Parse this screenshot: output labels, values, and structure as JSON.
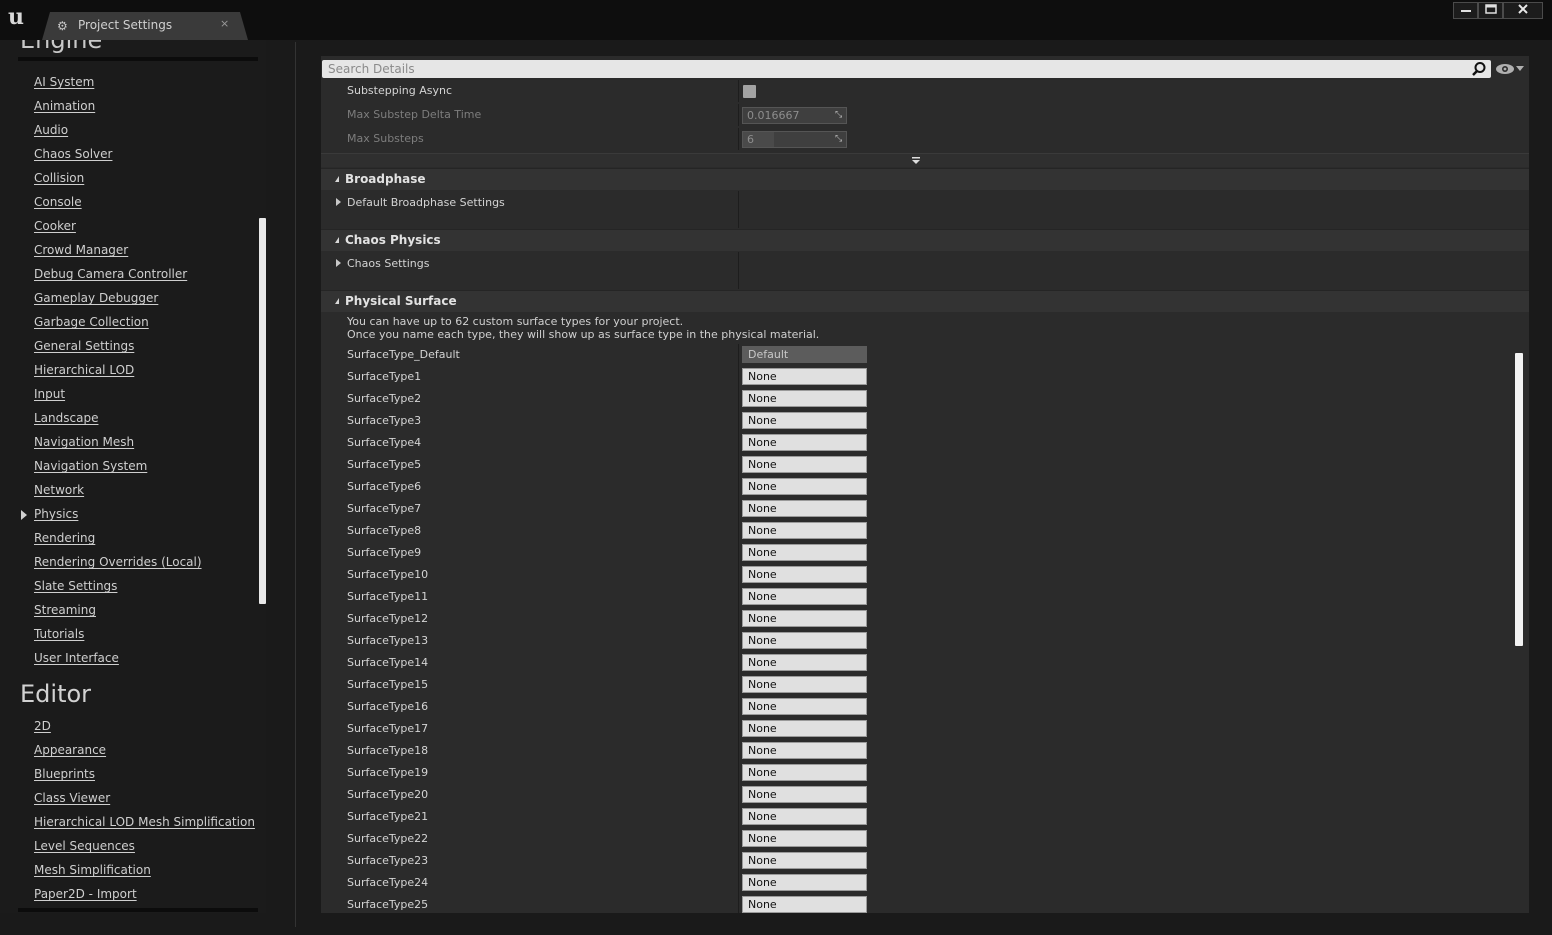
{
  "window": {
    "tab_title": "Project Settings",
    "tab_close": "×",
    "minimize": "▬",
    "maximize": "▭",
    "close": "✕"
  },
  "sidebar": {
    "engine_heading": "Engine",
    "engine_items": [
      {
        "label": "AI System"
      },
      {
        "label": "Animation"
      },
      {
        "label": "Audio"
      },
      {
        "label": "Chaos Solver"
      },
      {
        "label": "Collision"
      },
      {
        "label": "Console"
      },
      {
        "label": "Cooker"
      },
      {
        "label": "Crowd Manager"
      },
      {
        "label": "Debug Camera Controller"
      },
      {
        "label": "Gameplay Debugger"
      },
      {
        "label": "Garbage Collection"
      },
      {
        "label": "General Settings"
      },
      {
        "label": "Hierarchical LOD"
      },
      {
        "label": "Input"
      },
      {
        "label": "Landscape"
      },
      {
        "label": "Navigation Mesh"
      },
      {
        "label": "Navigation System"
      },
      {
        "label": "Network"
      },
      {
        "label": "Physics",
        "selected": true
      },
      {
        "label": "Rendering"
      },
      {
        "label": "Rendering Overrides (Local)"
      },
      {
        "label": "Slate Settings"
      },
      {
        "label": "Streaming"
      },
      {
        "label": "Tutorials"
      },
      {
        "label": "User Interface"
      }
    ],
    "editor_heading": "Editor",
    "editor_items": [
      {
        "label": "2D"
      },
      {
        "label": "Appearance"
      },
      {
        "label": "Blueprints"
      },
      {
        "label": "Class Viewer"
      },
      {
        "label": "Hierarchical LOD Mesh Simplification"
      },
      {
        "label": "Level Sequences"
      },
      {
        "label": "Mesh Simplification"
      },
      {
        "label": "Paper2D - Import"
      }
    ]
  },
  "details": {
    "search_placeholder": "Search Details",
    "substep": {
      "async_label": "Substepping Async",
      "max_delta_label": "Max Substep Delta Time",
      "max_delta_value": "0.016667",
      "max_substeps_label": "Max Substeps",
      "max_substeps_value": "6",
      "max_substeps_fill": 0.3
    },
    "sections": {
      "broadphase": {
        "title": "Broadphase",
        "group": "Default Broadphase Settings"
      },
      "chaos": {
        "title": "Chaos Physics",
        "group": "Chaos Settings"
      },
      "surface": {
        "title": "Physical Surface",
        "info_line1": "You can have up to 62 custom surface types for your project.",
        "info_line2": "Once you name each type, they will show up as surface type in the physical material.",
        "default_label": "SurfaceType_Default",
        "default_value": "Default",
        "types": [
          {
            "label": "SurfaceType1",
            "value": "None"
          },
          {
            "label": "SurfaceType2",
            "value": "None"
          },
          {
            "label": "SurfaceType3",
            "value": "None"
          },
          {
            "label": "SurfaceType4",
            "value": "None"
          },
          {
            "label": "SurfaceType5",
            "value": "None"
          },
          {
            "label": "SurfaceType6",
            "value": "None"
          },
          {
            "label": "SurfaceType7",
            "value": "None"
          },
          {
            "label": "SurfaceType8",
            "value": "None"
          },
          {
            "label": "SurfaceType9",
            "value": "None"
          },
          {
            "label": "SurfaceType10",
            "value": "None"
          },
          {
            "label": "SurfaceType11",
            "value": "None"
          },
          {
            "label": "SurfaceType12",
            "value": "None"
          },
          {
            "label": "SurfaceType13",
            "value": "None"
          },
          {
            "label": "SurfaceType14",
            "value": "None"
          },
          {
            "label": "SurfaceType15",
            "value": "None"
          },
          {
            "label": "SurfaceType16",
            "value": "None"
          },
          {
            "label": "SurfaceType17",
            "value": "None"
          },
          {
            "label": "SurfaceType18",
            "value": "None"
          },
          {
            "label": "SurfaceType19",
            "value": "None"
          },
          {
            "label": "SurfaceType20",
            "value": "None"
          },
          {
            "label": "SurfaceType21",
            "value": "None"
          },
          {
            "label": "SurfaceType22",
            "value": "None"
          },
          {
            "label": "SurfaceType23",
            "value": "None"
          },
          {
            "label": "SurfaceType24",
            "value": "None"
          },
          {
            "label": "SurfaceType25",
            "value": "None"
          }
        ]
      }
    }
  }
}
